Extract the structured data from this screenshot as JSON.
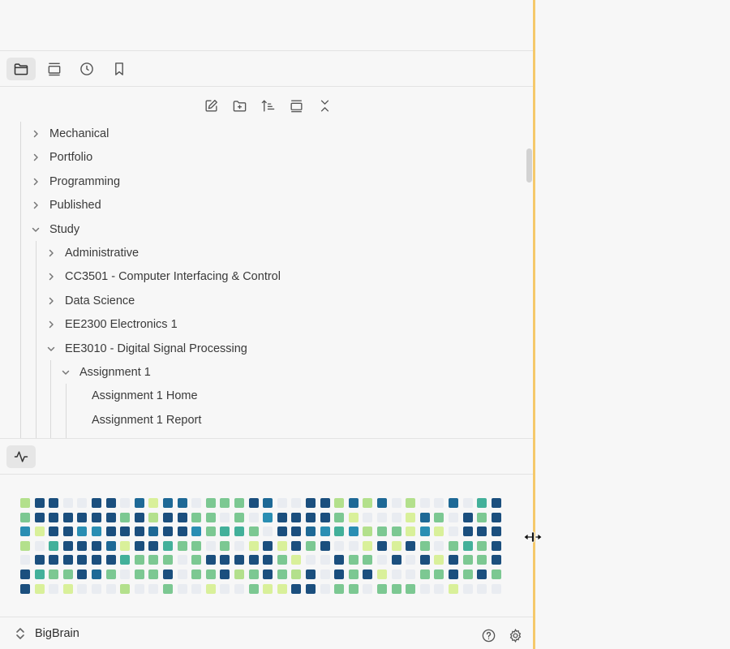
{
  "tabs": [
    {
      "icon": "folder-icon",
      "active": true
    },
    {
      "icon": "search-icon",
      "active": false
    },
    {
      "icon": "clock-icon",
      "active": false
    },
    {
      "icon": "bookmark-icon",
      "active": false
    }
  ],
  "toolbar": [
    "new-note-icon",
    "new-folder-icon",
    "sort-icon",
    "expand-icon",
    "collapse-icon"
  ],
  "tree": [
    {
      "label": "Mechanical",
      "level": 0,
      "expanded": false,
      "type": "folder"
    },
    {
      "label": "Portfolio",
      "level": 0,
      "expanded": false,
      "type": "folder"
    },
    {
      "label": "Programming",
      "level": 0,
      "expanded": false,
      "type": "folder"
    },
    {
      "label": "Published",
      "level": 0,
      "expanded": false,
      "type": "folder"
    },
    {
      "label": "Study",
      "level": 0,
      "expanded": true,
      "type": "folder"
    },
    {
      "label": "Administrative",
      "level": 1,
      "expanded": false,
      "type": "folder"
    },
    {
      "label": "CC3501 - Computer Interfacing & Control",
      "level": 1,
      "expanded": false,
      "type": "folder"
    },
    {
      "label": "Data Science",
      "level": 1,
      "expanded": false,
      "type": "folder"
    },
    {
      "label": "EE2300 Electronics 1",
      "level": 1,
      "expanded": false,
      "type": "folder"
    },
    {
      "label": "EE3010 - Digital Signal Processing",
      "level": 1,
      "expanded": true,
      "type": "folder"
    },
    {
      "label": "Assignment 1",
      "level": 2,
      "expanded": true,
      "type": "folder"
    },
    {
      "label": "Assignment 1 Home",
      "level": 3,
      "type": "file"
    },
    {
      "label": "Assignment 1 Report",
      "level": 3,
      "type": "file"
    }
  ],
  "heatmap": {
    "colors": [
      "#e9ecf1",
      "#b3e08c",
      "#d9f09a",
      "#7cc892",
      "#43b09a",
      "#2a8eb3",
      "#1e6996",
      "#1b4f7e"
    ],
    "rows": [
      "1770077062660333760077161601006047",
      "3777777371773303057777320002630737",
      "5277557776775344307765451332520777",
      "1047776277433030272737002727303437",
      "0777777433303777773200733070727337",
      "7433763033703371373170737200337373",
      "7202000100300200322770330333002000"
    ]
  },
  "footer": {
    "vault_name": "BigBrain"
  }
}
